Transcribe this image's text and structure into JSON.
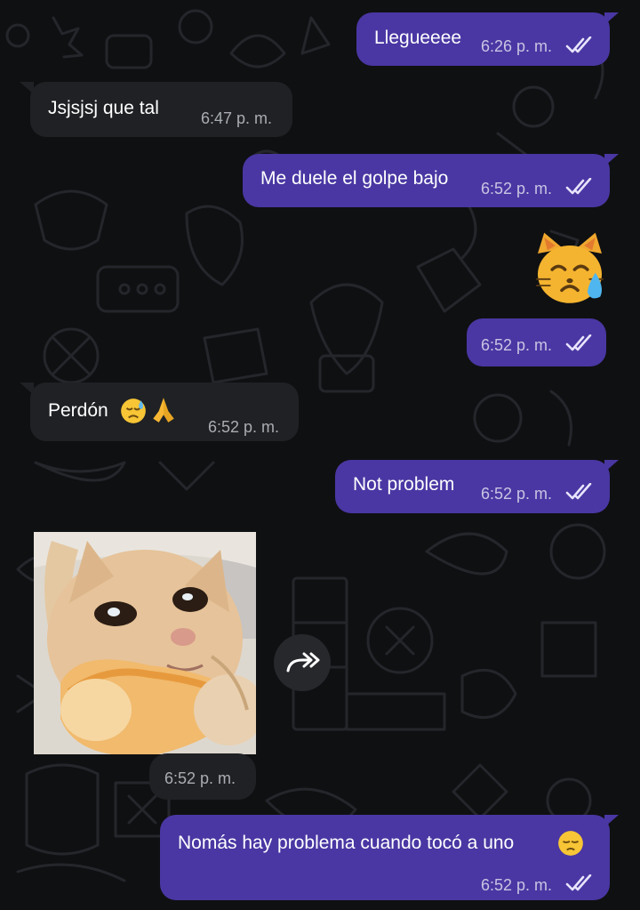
{
  "chat": {
    "messages": [
      {
        "id": "m1",
        "direction": "out",
        "text": "Llegueeee",
        "time": "6:26 p. m.",
        "read": true
      },
      {
        "id": "m2",
        "direction": "in",
        "text": "Jsjsjsj que tal",
        "time": "6:47 p. m."
      },
      {
        "id": "m3",
        "direction": "out",
        "text": "Me duele el golpe bajo",
        "time": "6:52 p. m.",
        "read": true
      },
      {
        "id": "m4",
        "direction": "out",
        "emoji": "crying-cat-face",
        "time": "6:52 p. m.",
        "read": true
      },
      {
        "id": "m5",
        "direction": "in",
        "text": "Perdón",
        "emojis": [
          "sad-but-relieved-face",
          "folded-hands"
        ],
        "time": "6:52 p. m."
      },
      {
        "id": "m6",
        "direction": "out",
        "text": "Not problem",
        "time": "6:52 p. m.",
        "read": true
      },
      {
        "id": "m7",
        "direction": "in",
        "image": "crying-cat-eating-bread-sticker",
        "time": "6:52 p. m.",
        "action": "forward-icon"
      },
      {
        "id": "m8",
        "direction": "out",
        "text": "Nomás hay problema cuando tocó a uno",
        "emoji": "pensive-face",
        "time": "6:52 p. m.",
        "read": true
      }
    ]
  },
  "colors": {
    "background": "#0f1012",
    "outgoing_bubble": "#4a37a3",
    "incoming_bubble": "#1f2124",
    "outgoing_time": "#c9c4e3",
    "incoming_time": "#a9acb2"
  }
}
